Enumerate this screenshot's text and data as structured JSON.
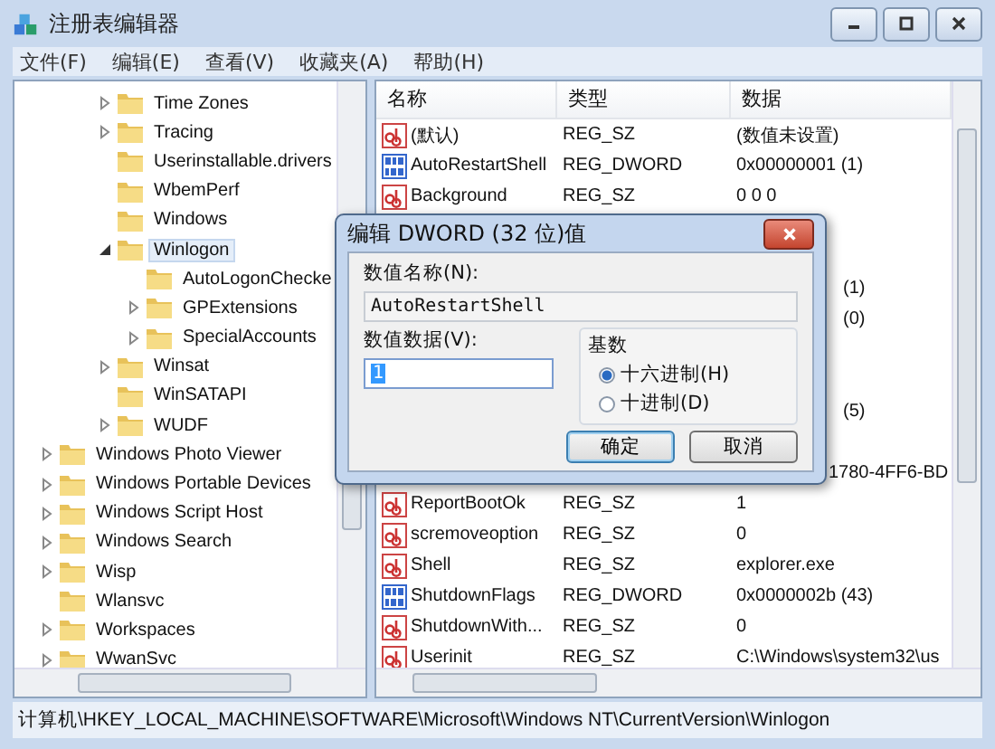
{
  "window": {
    "title": "注册表编辑器"
  },
  "menu": [
    "文件(F)",
    "编辑(E)",
    "查看(V)",
    "收藏夹(A)",
    "帮助(H)"
  ],
  "tree": {
    "items": [
      {
        "children": [
          {
            "label": "Time Zones",
            "expandable": true,
            "expanded": false,
            "selected": false
          },
          {
            "label": "Tracing",
            "expandable": true,
            "expanded": false,
            "selected": false
          },
          {
            "label": "Userinstallable.drivers",
            "expandable": false,
            "selected": false
          },
          {
            "label": "WbemPerf",
            "expandable": false,
            "selected": false
          },
          {
            "label": "Windows",
            "expandable": false,
            "selected": false
          },
          {
            "label": "Winlogon",
            "expandable": true,
            "expanded": true,
            "selected": true,
            "children": [
              {
                "label": "AutoLogonChecke",
                "expandable": false,
                "selected": false
              },
              {
                "label": "GPExtensions",
                "expandable": true,
                "expanded": false,
                "selected": false
              },
              {
                "label": "SpecialAccounts",
                "expandable": true,
                "expanded": false,
                "selected": false
              }
            ]
          },
          {
            "label": "Winsat",
            "expandable": true,
            "expanded": false,
            "selected": false
          },
          {
            "label": "WinSATAPI",
            "expandable": false,
            "selected": false
          },
          {
            "label": "WUDF",
            "expandable": true,
            "expanded": false,
            "selected": false
          }
        ]
      },
      {
        "label": "Windows Photo Viewer",
        "expandable": true,
        "expanded": false,
        "selected": false
      },
      {
        "label": "Windows Portable Devices",
        "expandable": true,
        "expanded": false,
        "selected": false
      },
      {
        "label": "Windows Script Host",
        "expandable": true,
        "expanded": false,
        "selected": false
      },
      {
        "label": "Windows Search",
        "expandable": true,
        "expanded": false,
        "selected": false
      },
      {
        "label": "Wisp",
        "expandable": true,
        "expanded": false,
        "selected": false
      },
      {
        "label": "Wlansvc",
        "expandable": false,
        "selected": false
      },
      {
        "label": "Workspaces",
        "expandable": true,
        "expanded": false,
        "selected": false
      },
      {
        "label": "WwanSvc",
        "expandable": true,
        "expanded": false,
        "selected": false
      }
    ]
  },
  "values": {
    "columns": [
      "名称",
      "类型",
      "数据"
    ],
    "rows": [
      {
        "kind": "string",
        "name": "(默认)",
        "type": "REG_SZ",
        "data": "(数值未设置)"
      },
      {
        "kind": "dword",
        "name": "AutoRestartShell",
        "type": "REG_DWORD",
        "data": "0x00000001 (1)"
      },
      {
        "kind": "string",
        "name": "Background",
        "type": "REG_SZ",
        "data": "0 0 0"
      },
      {
        "kind": "hidden"
      },
      {
        "kind": "hidden"
      },
      {
        "kind": "hidden",
        "data": "(1)"
      },
      {
        "kind": "hidden",
        "data": "(0)"
      },
      {
        "kind": "hidden"
      },
      {
        "kind": "hidden"
      },
      {
        "kind": "hidden",
        "data": "(5)"
      },
      {
        "kind": "hidden"
      },
      {
        "kind": "hidden_edge",
        "data": "1780-4FF6-BD"
      },
      {
        "kind": "string",
        "name": "ReportBootOk",
        "type": "REG_SZ",
        "data": "1"
      },
      {
        "kind": "string",
        "name": "scremoveoption",
        "type": "REG_SZ",
        "data": "0"
      },
      {
        "kind": "string",
        "name": "Shell",
        "type": "REG_SZ",
        "data": "explorer.exe"
      },
      {
        "kind": "dword",
        "name": "ShutdownFlags",
        "type": "REG_DWORD",
        "data": "0x0000002b (43)"
      },
      {
        "kind": "string",
        "name": "ShutdownWith...",
        "type": "REG_SZ",
        "data": "0"
      },
      {
        "kind": "string",
        "name": "Userinit",
        "type": "REG_SZ",
        "data": "C:\\Windows\\system32\\us"
      }
    ]
  },
  "dialog": {
    "title": "编辑 DWORD (32 位)值",
    "name_label": "数值名称(N):",
    "name_value": "AutoRestartShell",
    "data_label": "数值数据(V):",
    "data_value": "1",
    "base_label": "基数",
    "bases": [
      {
        "label": "十六进制(H)",
        "selected": true
      },
      {
        "label": "十进制(D)",
        "selected": false
      }
    ],
    "buttons": [
      "确定",
      "取消"
    ]
  },
  "status_bar": "计算机\\HKEY_LOCAL_MACHINE\\SOFTWARE\\Microsoft\\Windows NT\\CurrentVersion\\Winlogon"
}
